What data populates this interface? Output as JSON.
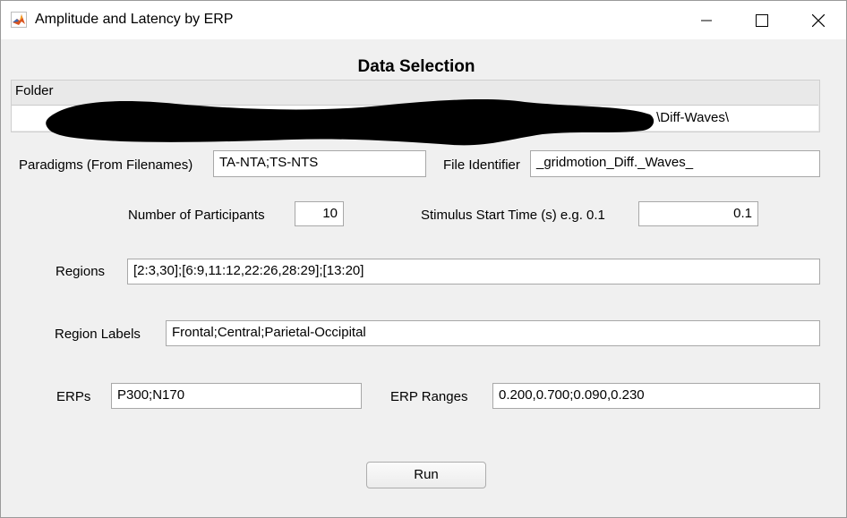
{
  "window": {
    "title": "Amplitude and Latency by ERP",
    "controls": {
      "minimize": "minimize-icon",
      "maximize": "maximize-icon",
      "close": "close-icon"
    }
  },
  "heading": "Data Selection",
  "folder": {
    "label": "Folder",
    "value": "\\Diff-Waves\\"
  },
  "form": {
    "paradigms": {
      "label": "Paradigms (From Filenames)",
      "value": "TA-NTA;TS-NTS"
    },
    "file_identifier": {
      "label": "File Identifier",
      "value": "_gridmotion_Diff._Waves_"
    },
    "participants": {
      "label": "Number of Participants",
      "value": "10"
    },
    "stimulus_start": {
      "label": "Stimulus Start Time (s) e.g. 0.1",
      "value": "0.1"
    },
    "regions": {
      "label": "Regions",
      "value": "[2:3,30];[6:9,11:12,22:26,28:29];[13:20]"
    },
    "region_labels": {
      "label": "Region Labels",
      "value": "Frontal;Central;Parietal-Occipital"
    },
    "erps": {
      "label": "ERPs",
      "value": "P300;N170"
    },
    "erp_ranges": {
      "label": "ERP Ranges",
      "value": "0.200,0.700;0.090,0.230"
    }
  },
  "run_button": {
    "label": "Run"
  },
  "colors": {
    "background": "#f0f0f0",
    "field": "#ffffff",
    "field_border": "#a8a8a8",
    "titlebar": "#ffffff"
  }
}
